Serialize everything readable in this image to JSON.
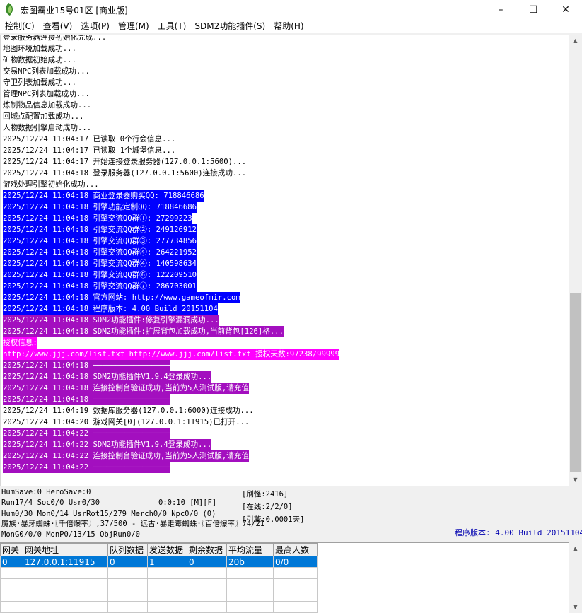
{
  "window": {
    "title": "宏图霸业15号01区 [商业版]",
    "minimize": "–",
    "maximize": "☐",
    "close": "✕"
  },
  "menu": [
    "控制(C)",
    "查看(V)",
    "选项(P)",
    "管理(M)",
    "工具(T)",
    "SDM2功能插件(S)",
    "帮助(H)"
  ],
  "log": [
    {
      "text": "登录服务器连接初始化完成...",
      "style": ""
    },
    {
      "text": "地图环境加载成功...",
      "style": ""
    },
    {
      "text": "矿物数据初始成功...",
      "style": ""
    },
    {
      "text": "交易NPC列表加载成功...",
      "style": ""
    },
    {
      "text": "守卫列表加载成功...",
      "style": ""
    },
    {
      "text": "管理NPC列表加载成功...",
      "style": ""
    },
    {
      "text": "炼制物品信息加载成功...",
      "style": ""
    },
    {
      "text": "回城点配置加载成功...",
      "style": ""
    },
    {
      "text": "人物数据引擎启动成功...",
      "style": ""
    },
    {
      "text": "2025/12/24 11:04:17 已读取 0个行会信息...",
      "style": ""
    },
    {
      "text": "2025/12/24 11:04:17 已读取 1个城堡信息...",
      "style": ""
    },
    {
      "text": "2025/12/24 11:04:17 开始连接登录服务器(127.0.0.1:5600)...",
      "style": ""
    },
    {
      "text": "2025/12/24 11:04:18 登录服务器(127.0.0.1:5600)连接成功...",
      "style": ""
    },
    {
      "text": "游戏处理引擎初始化成功...",
      "style": ""
    },
    {
      "text": "2025/12/24 11:04:18 商业登录器购买QQ: 718846686",
      "style": "blue"
    },
    {
      "text": "2025/12/24 11:04:18 引擎功能定制QQ: 718846686",
      "style": "blue"
    },
    {
      "text": "2025/12/24 11:04:18 引擎交流QQ群①: 27299223",
      "style": "blue"
    },
    {
      "text": "2025/12/24 11:04:18 引擎交流QQ群②: 249126912",
      "style": "blue"
    },
    {
      "text": "2025/12/24 11:04:18 引擎交流QQ群③: 277734856",
      "style": "blue"
    },
    {
      "text": "2025/12/24 11:04:18 引擎交流QQ群④: 264221952",
      "style": "blue"
    },
    {
      "text": "2025/12/24 11:04:18 引擎交流QQ群④: 140598634",
      "style": "blue"
    },
    {
      "text": "2025/12/24 11:04:18 引擎交流QQ群⑥: 122209510",
      "style": "blue"
    },
    {
      "text": "2025/12/24 11:04:18 引擎交流QQ群⑦: 286703001",
      "style": "blue"
    },
    {
      "text": "2025/12/24 11:04:18 官方网站: http://www.gameofmir.com",
      "style": "blue"
    },
    {
      "text": "2025/12/24 11:04:18 程序版本: 4.00 Build 20151104",
      "style": "blue"
    },
    {
      "text": "2025/12/24 11:04:18 SDM2功能插件:修复引擎漏洞成功...",
      "style": "purple"
    },
    {
      "text": "2025/12/24 11:04:18 SDM2功能插件:扩展背包加载成功,当前背包[126]格...",
      "style": "purple"
    },
    {
      "text": "授权信息:",
      "style": "magenta"
    },
    {
      "text": "http://www.jjj.com/list.txt http://www.jjj.com/list.txt 授权天数:97238/99999",
      "style": "magenta"
    },
    {
      "text": "2025/12/24 11:04:18 ─────────────────",
      "style": "purple"
    },
    {
      "text": "2025/12/24 11:04:18 SDM2功能插件V1.9.4登录成功...",
      "style": "purple"
    },
    {
      "text": "2025/12/24 11:04:18 连接控制台验证成功,当前为5人测试版,请充值",
      "style": "purple"
    },
    {
      "text": "2025/12/24 11:04:18 ─────────────────",
      "style": "purple"
    },
    {
      "text": "2025/12/24 11:04:19 数据库服务器(127.0.0.1:6000)连接成功...",
      "style": ""
    },
    {
      "text": "2025/12/24 11:04:20 游戏网关[0](127.0.0.1:11915)已打开...",
      "style": ""
    },
    {
      "text": "2025/12/24 11:04:22 ─────────────────",
      "style": "purple"
    },
    {
      "text": "2025/12/24 11:04:22 SDM2功能插件V1.9.4登录成功...",
      "style": "purple"
    },
    {
      "text": "2025/12/24 11:04:22 连接控制台验证成功,当前为5人测试版,请充值",
      "style": "purple"
    },
    {
      "text": "2025/12/24 11:04:22 ─────────────────",
      "style": "purple"
    }
  ],
  "status": {
    "line1": "HumSave:0 HeroSave:0",
    "line2_left": "Run17/4 Soc0/0 Usr0/30",
    "line2_mid": "0:0:10 [M][F]",
    "line3": "Hum0/30 Mon0/14 UsrRot15/279 Merch0/0 Npc0/0 (0)",
    "line4": "魔族·暴牙蜘蛛·〖千倍爆率〗,37/500 - 远古·暴走毒蜘蛛·〖百倍爆率〗74/21",
    "line5": "MonG0/0/0 MonP0/13/15 ObjRun0/0",
    "refresh": "[刷怪:2416]",
    "online": "[在线:2/2/0]",
    "engine": "[引擎:0.0001天]",
    "version": "程序版本: 4.00 Build 20151104"
  },
  "gateway": {
    "headers": [
      "网关",
      "网关地址",
      "队列数据",
      "发送数据",
      "剩余数据",
      "平均流量",
      "最高人数"
    ],
    "rows": [
      [
        "0",
        "127.0.0.1:11915",
        "0",
        "1",
        "0",
        "20b",
        "0/0"
      ]
    ]
  }
}
